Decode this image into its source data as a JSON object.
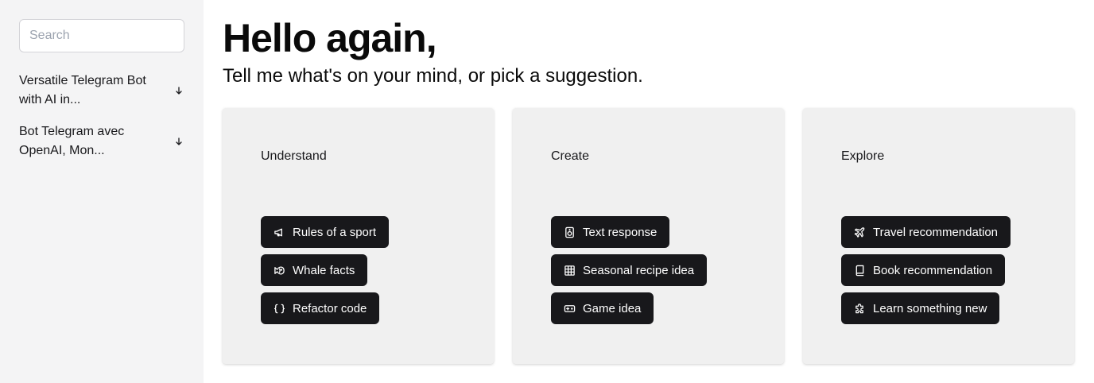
{
  "sidebar": {
    "search": {
      "placeholder": "Search",
      "value": ""
    },
    "conversations": [
      {
        "title": "Versatile Telegram Bot with AI in...",
        "icon": "arrow-down-icon"
      },
      {
        "title": "Bot Telegram avec OpenAI, Mon...",
        "icon": "arrow-down-icon"
      }
    ]
  },
  "main": {
    "greeting": "Hello again,",
    "subtitle": "Tell me what's on your mind, or pick a suggestion.",
    "cards": [
      {
        "title": "Understand",
        "suggestions": [
          {
            "label": "Rules of a sport",
            "icon": "megaphone-icon"
          },
          {
            "label": "Whale facts",
            "icon": "fish-icon"
          },
          {
            "label": "Refactor code",
            "icon": "braces-icon"
          }
        ]
      },
      {
        "title": "Create",
        "suggestions": [
          {
            "label": "Text response",
            "icon": "speaker-icon"
          },
          {
            "label": "Seasonal recipe idea",
            "icon": "grid-icon"
          },
          {
            "label": "Game idea",
            "icon": "gamepad-icon"
          }
        ]
      },
      {
        "title": "Explore",
        "suggestions": [
          {
            "label": "Travel recommendation",
            "icon": "plane-icon"
          },
          {
            "label": "Book recommendation",
            "icon": "book-icon"
          },
          {
            "label": "Learn something new",
            "icon": "puzzle-icon"
          }
        ]
      }
    ]
  },
  "colors": {
    "sidebar_bg": "#f4f4f5",
    "card_bg": "#f0f0f0",
    "chip_bg": "#18181b",
    "chip_text": "#ffffff"
  }
}
